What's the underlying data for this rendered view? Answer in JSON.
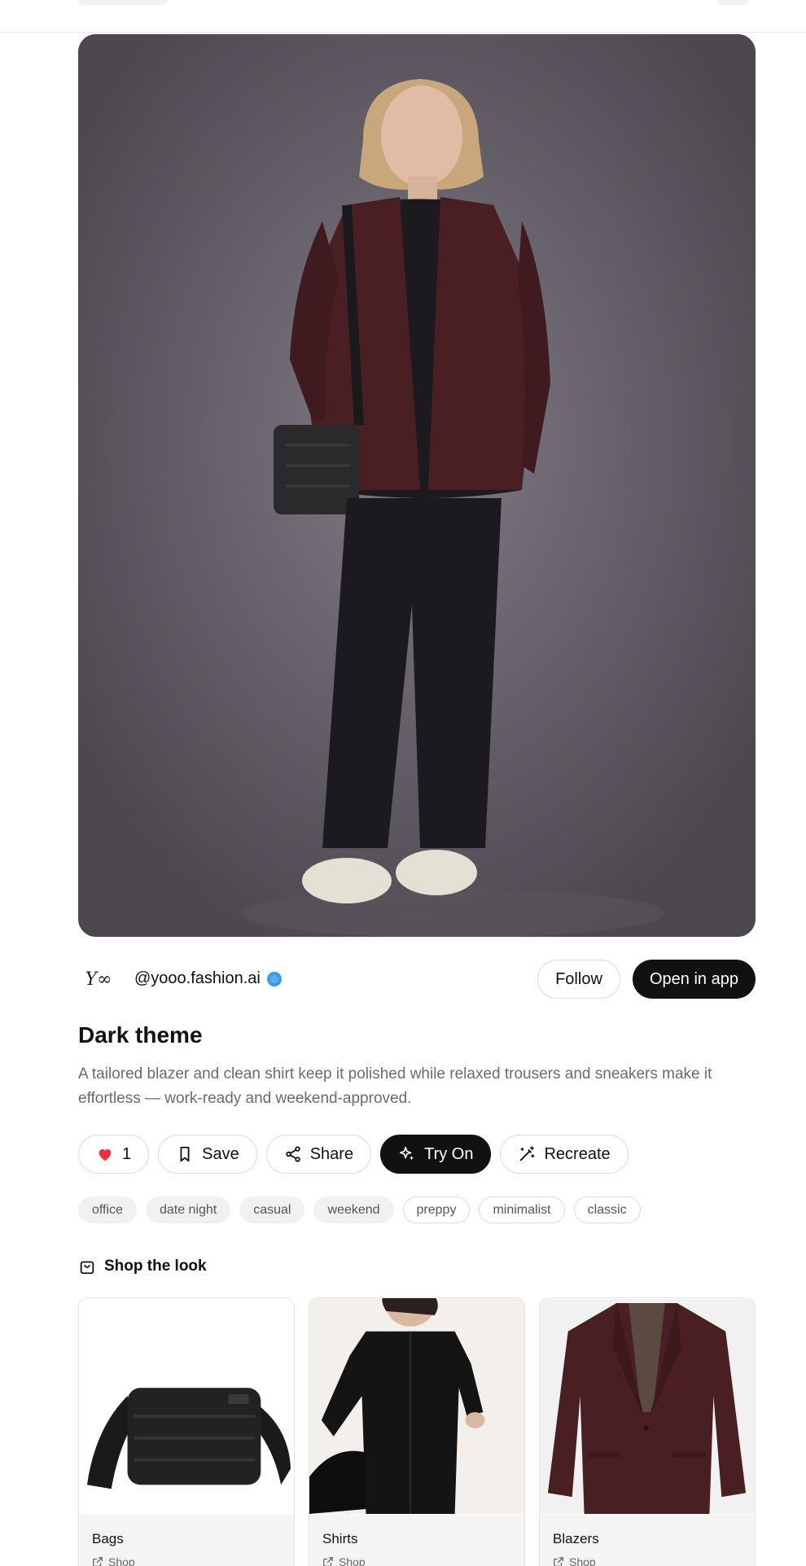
{
  "post": {
    "author_handle": "@yooo.fashion.ai",
    "logo_text": "Y∞",
    "follow_label": "Follow",
    "open_app_label": "Open in app",
    "title": "Dark theme",
    "description": "A tailored blazer and clean shirt keep it polished while relaxed trousers and sneakers make it effortless — work-ready and weekend-approved."
  },
  "actions": {
    "like_count": "1",
    "save_label": "Save",
    "share_label": "Share",
    "tryon_label": "Try On",
    "recreate_label": "Recreate"
  },
  "tags": [
    "office",
    "date night",
    "casual",
    "weekend",
    "preppy",
    "minimalist",
    "classic"
  ],
  "shop": {
    "heading": "Shop the look",
    "items": [
      {
        "category": "Bags",
        "link_label": "Shop"
      },
      {
        "category": "Shirts",
        "link_label": "Shop"
      },
      {
        "category": "Blazers",
        "link_label": "Shop"
      }
    ]
  },
  "icons": {
    "like": "heart-icon",
    "save": "bookmark-icon",
    "share": "share-icon",
    "tryon": "sparkle-icon",
    "recreate": "magic-wand-icon",
    "shop": "shopping-bag-icon",
    "link": "external-link-icon",
    "verified": "verified-badge-icon"
  },
  "colors": {
    "accent_dark": "#111111",
    "like_red": "#e8303f",
    "verified_blue": "#3d9be9",
    "blazer_burgundy": "#4a1f24"
  }
}
